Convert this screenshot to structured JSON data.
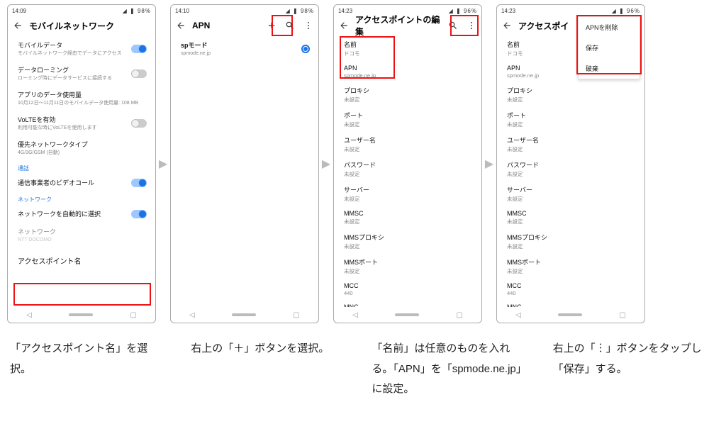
{
  "status": {
    "time1": "14:09",
    "time2": "14:10",
    "time3": "14:23",
    "time4": "14:23",
    "leftIcons": "✿ ⚙ ☐ ⋯",
    "rightIcons": "📶◢",
    "battery1": "98%",
    "battery2": "98%",
    "battery3": "96%",
    "battery4": "96%"
  },
  "s1": {
    "title": "モバイルネットワーク",
    "items": {
      "mdata": {
        "t": "モバイルデータ",
        "s": "モバイルネットワーク経由でデータにアクセス"
      },
      "roam": {
        "t": "データローミング",
        "s": "ローミング時にデータサービスに接続する"
      },
      "usage": {
        "t": "アプリのデータ使用量",
        "s": "10月12日～11月11日のモバイルデータ使用量: 108 MB"
      },
      "volte": {
        "t": "VoLTEを有効",
        "s": "利用可能な時にVoLTEを使用します"
      },
      "ntype": {
        "t": "優先ネットワークタイプ",
        "s": "4G/3G/GSM (自動)"
      },
      "sec_call": "通話",
      "vcall": {
        "t": "通信事業者のビデオコール"
      },
      "sec_net": "ネットワーク",
      "auto": {
        "t": "ネットワークを自動的に選択"
      },
      "nw": {
        "t": "ネットワーク",
        "s": "NTT DOCOMO"
      },
      "apn": {
        "t": "アクセスポイント名"
      }
    }
  },
  "s2": {
    "title": "APN",
    "apn": {
      "name": "spモード",
      "host": "spmode.ne.jp"
    }
  },
  "s3": {
    "title": "アクセスポイントの編集",
    "fields": {
      "name": {
        "l": "名前",
        "v": "ドコモ"
      },
      "apn": {
        "l": "APN",
        "v": "spmode.ne.jp"
      },
      "proxy": {
        "l": "プロキシ",
        "v": "未設定"
      },
      "port": {
        "l": "ポート",
        "v": "未設定"
      },
      "user": {
        "l": "ユーザー名",
        "v": "未設定"
      },
      "pass": {
        "l": "パスワード",
        "v": "未設定"
      },
      "server": {
        "l": "サーバー",
        "v": "未設定"
      },
      "mmsc": {
        "l": "MMSC",
        "v": "未設定"
      },
      "mmsproxy": {
        "l": "MMSプロキシ",
        "v": "未設定"
      },
      "mmsport": {
        "l": "MMSポート",
        "v": "未設定"
      },
      "mcc": {
        "l": "MCC",
        "v": "440"
      },
      "mnc": {
        "l": "MNC",
        "v": ""
      }
    }
  },
  "s4": {
    "title": "アクセスポイ",
    "menu": {
      "delete": "APNを削除",
      "save": "保存",
      "discard": "破棄"
    }
  },
  "captions": {
    "c1": "「アクセスポイント名」を選択。",
    "c2": "右上の「＋」ボタンを選択。",
    "c3": "「名前」は任意のものを入れる。「APN」を「spmode.ne.jp」に設定。",
    "c4": "右上の「︙」ボタンをタップし「保存」する。"
  }
}
